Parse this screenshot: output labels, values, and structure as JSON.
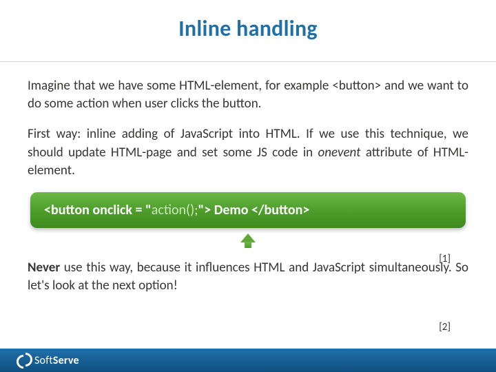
{
  "title": "Inline handling",
  "para1": "Imagine that we have some HTML-element, for example <button> and we want to do some action when user clicks the button.",
  "para2_a": "First way: inline adding of JavaScript into HTML. If we use this technique, we should update HTML-page and set some JS code in ",
  "para2_italic": "onevent",
  "para2_b": " attribute of HTML-element.",
  "code_a": "<button onclick = \"",
  "code_dim": "action();",
  "code_b": "\"> Demo </button>",
  "ref1": "[1]",
  "ref2": "[2]",
  "para3_bold": "Never",
  "para3_rest": " use this way, because it influences HTML and JavaScript simultaneously. So let's look at the next option!",
  "footer_soft": "Soft",
  "footer_serve": "Serve"
}
